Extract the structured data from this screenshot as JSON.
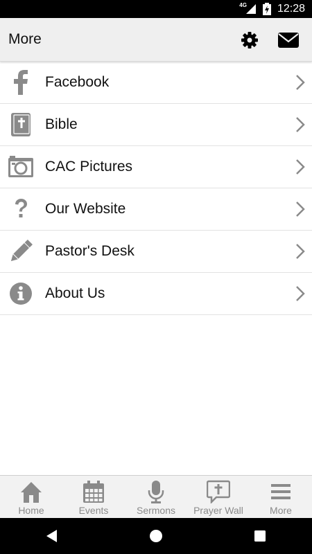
{
  "status_bar": {
    "network": "4G",
    "time": "12:28"
  },
  "header": {
    "title": "More",
    "settings_icon": "gear-icon",
    "mail_icon": "mail-icon"
  },
  "menu": {
    "items": [
      {
        "label": "Facebook",
        "icon": "facebook-icon"
      },
      {
        "label": "Bible",
        "icon": "bible-icon"
      },
      {
        "label": "CAC Pictures",
        "icon": "camera-icon"
      },
      {
        "label": "Our Website",
        "icon": "question-icon"
      },
      {
        "label": "Pastor's Desk",
        "icon": "pencil-icon"
      },
      {
        "label": "About Us",
        "icon": "info-icon"
      }
    ]
  },
  "tabs": [
    {
      "label": "Home",
      "icon": "home-icon"
    },
    {
      "label": "Events",
      "icon": "calendar-icon"
    },
    {
      "label": "Sermons",
      "icon": "microphone-icon"
    },
    {
      "label": "Prayer Wall",
      "icon": "prayer-bubble-icon"
    },
    {
      "label": "More",
      "icon": "menu-icon"
    }
  ],
  "colors": {
    "icon_gray": "#8a8a8a",
    "header_bg": "#efefef",
    "status_bg": "#000000"
  }
}
